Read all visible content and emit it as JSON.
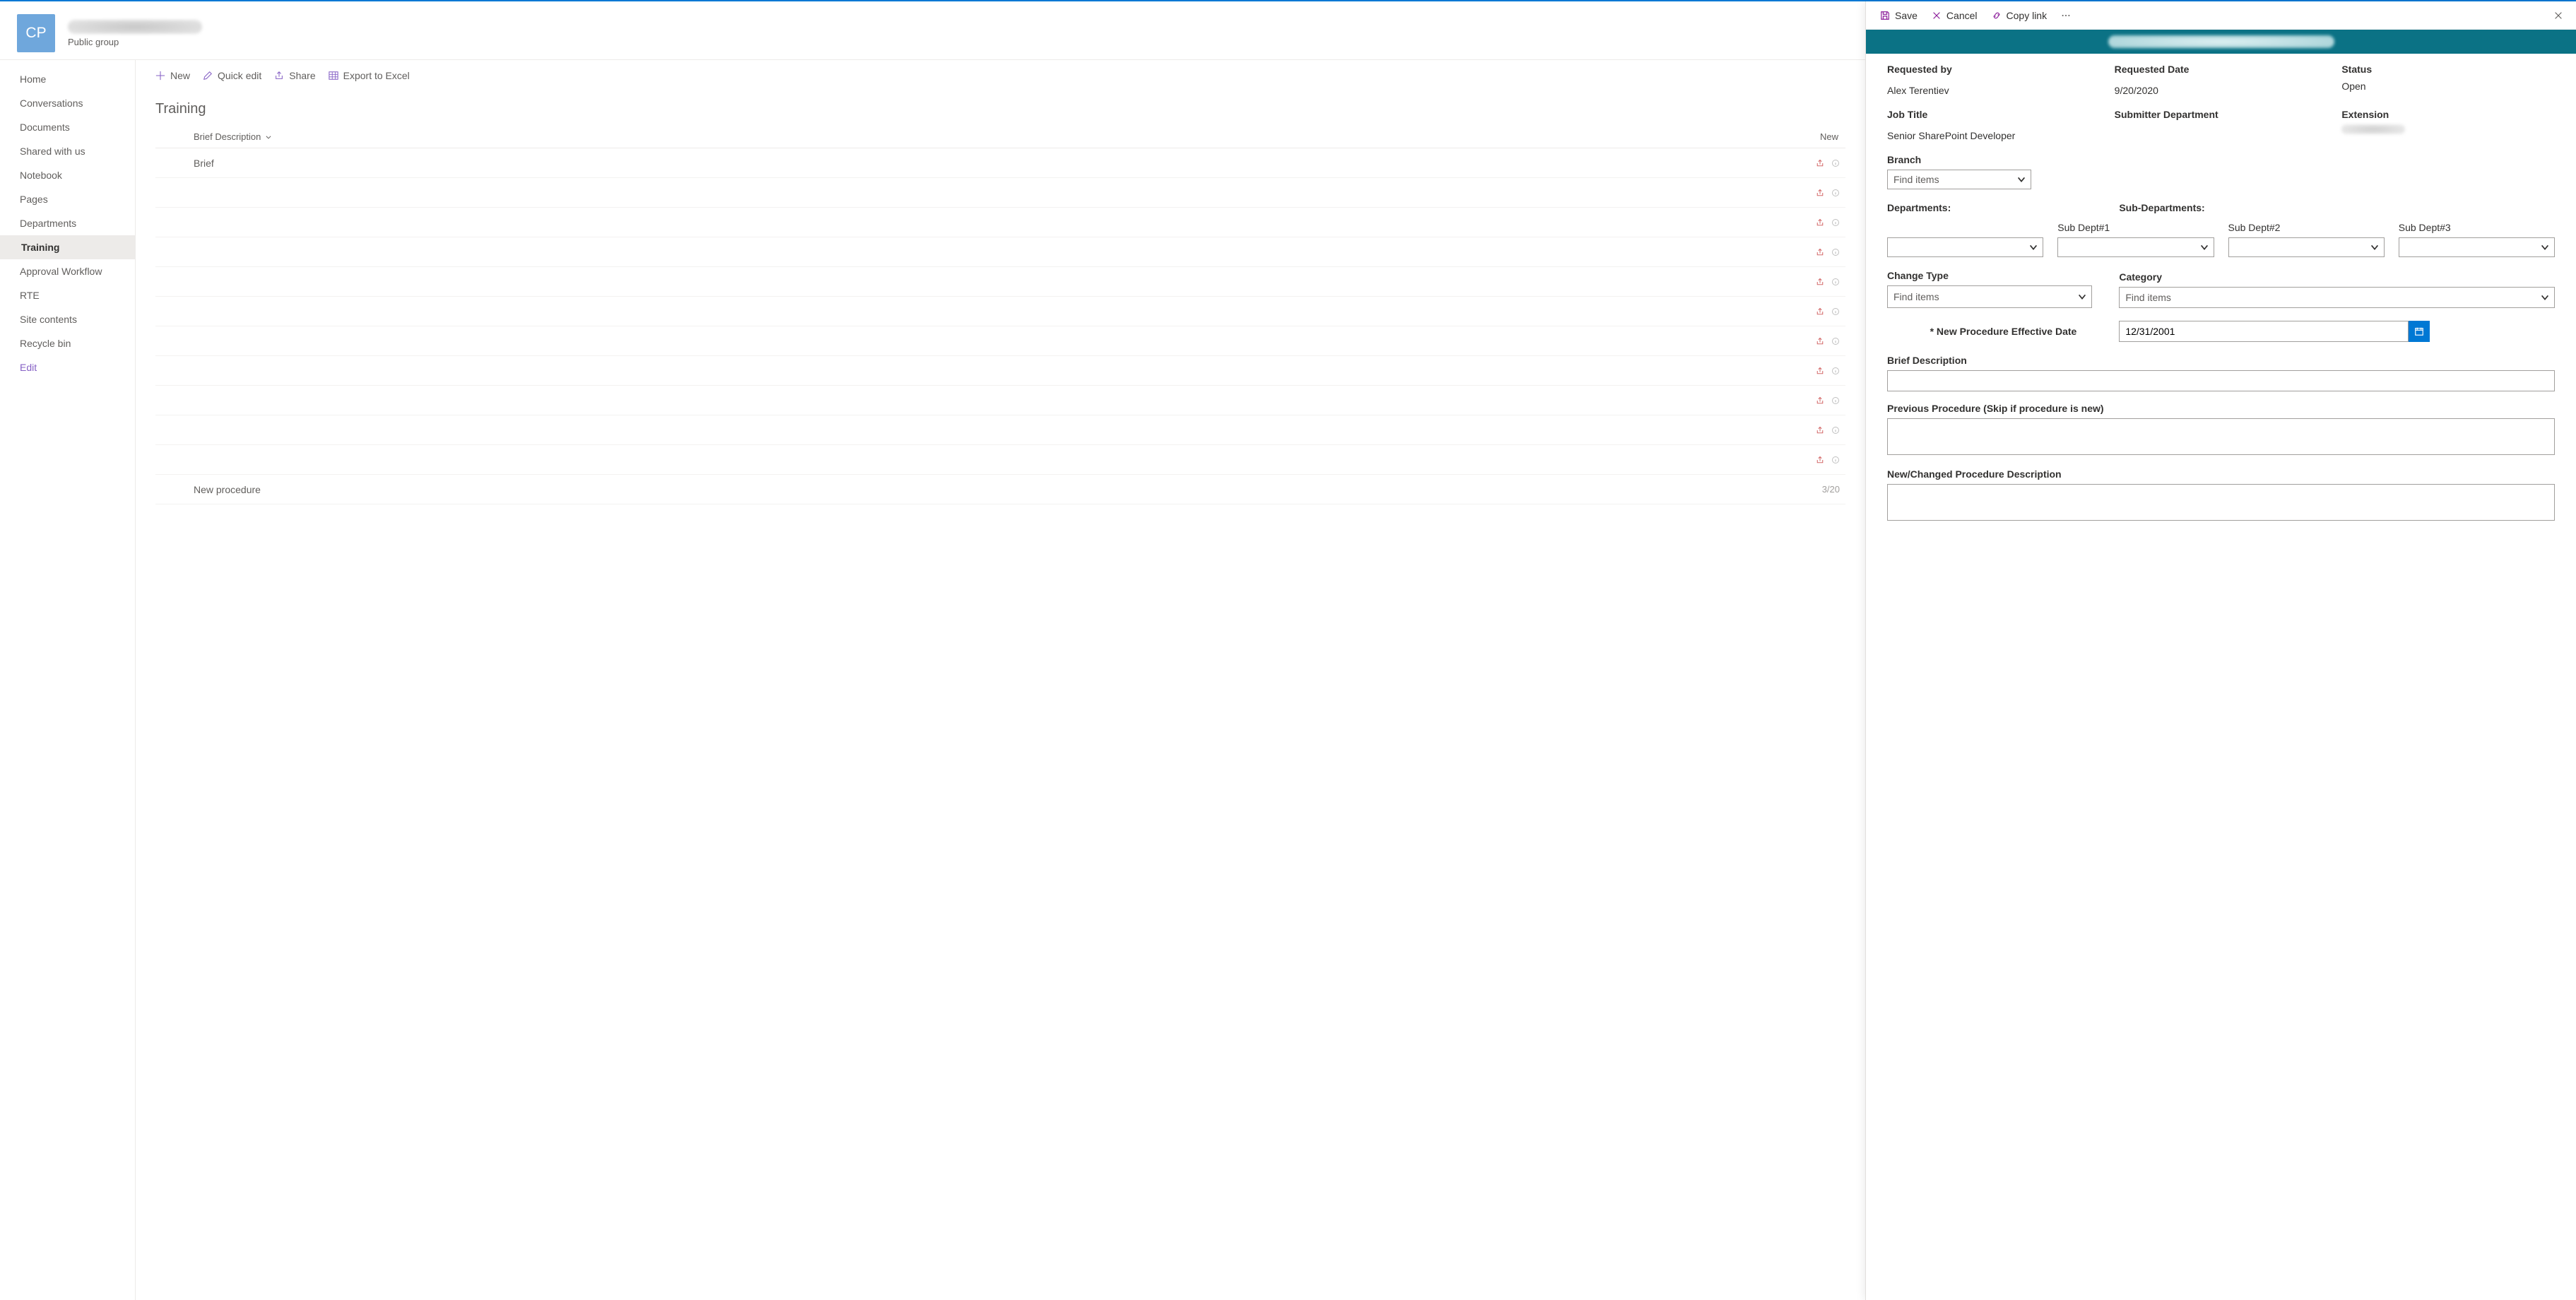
{
  "site": {
    "logo_initials": "CP",
    "subtitle": "Public group"
  },
  "nav": {
    "items": [
      {
        "label": "Home"
      },
      {
        "label": "Conversations"
      },
      {
        "label": "Documents"
      },
      {
        "label": "Shared with us"
      },
      {
        "label": "Notebook"
      },
      {
        "label": "Pages"
      },
      {
        "label": "Departments"
      },
      {
        "label": "Training"
      },
      {
        "label": "Approval Workflow"
      },
      {
        "label": "RTE"
      },
      {
        "label": "Site contents"
      },
      {
        "label": "Recycle bin"
      }
    ],
    "edit_label": "Edit",
    "selected_index": 7
  },
  "commandbar": {
    "new": "New",
    "quick_edit": "Quick edit",
    "share": "Share",
    "export": "Export to Excel"
  },
  "list": {
    "title": "Training",
    "columns": {
      "brief": "Brief Description",
      "new": "New"
    },
    "rows": [
      {
        "title": "Brief",
        "date": ""
      },
      {
        "title": "",
        "date": ""
      },
      {
        "title": "",
        "date": ""
      },
      {
        "title": "",
        "date": ""
      },
      {
        "title": "",
        "date": ""
      },
      {
        "title": "",
        "date": ""
      },
      {
        "title": "",
        "date": ""
      },
      {
        "title": "",
        "date": ""
      },
      {
        "title": "",
        "date": ""
      },
      {
        "title": "",
        "date": ""
      },
      {
        "title": "",
        "date": ""
      },
      {
        "title": "New procedure",
        "date": "3/20"
      }
    ]
  },
  "panel": {
    "cmd": {
      "save": "Save",
      "cancel": "Cancel",
      "copy_link": "Copy link"
    },
    "labels": {
      "requested_by": "Requested by",
      "requested_date": "Requested Date",
      "status": "Status",
      "job_title": "Job Title",
      "submitter_department": "Submitter Department",
      "extension": "Extension",
      "branch": "Branch",
      "departments": "Departments:",
      "sub_departments": "Sub-Departments:",
      "sub1": "Sub Dept#1",
      "sub2": "Sub Dept#2",
      "sub3": "Sub Dept#3",
      "change_type": "Change Type",
      "category": "Category",
      "effective_date": "* New Procedure Effective Date",
      "brief_description": "Brief Description",
      "previous_procedure": "Previous Procedure (Skip if procedure is new)",
      "new_changed_desc": "New/Changed Procedure Description"
    },
    "values": {
      "requested_by": "Alex Terentiev",
      "requested_date": "9/20/2020",
      "status": "Open",
      "job_title": "Senior SharePoint Developer",
      "effective_date": "12/31/2001"
    },
    "placeholders": {
      "find_items": "Find items"
    }
  }
}
